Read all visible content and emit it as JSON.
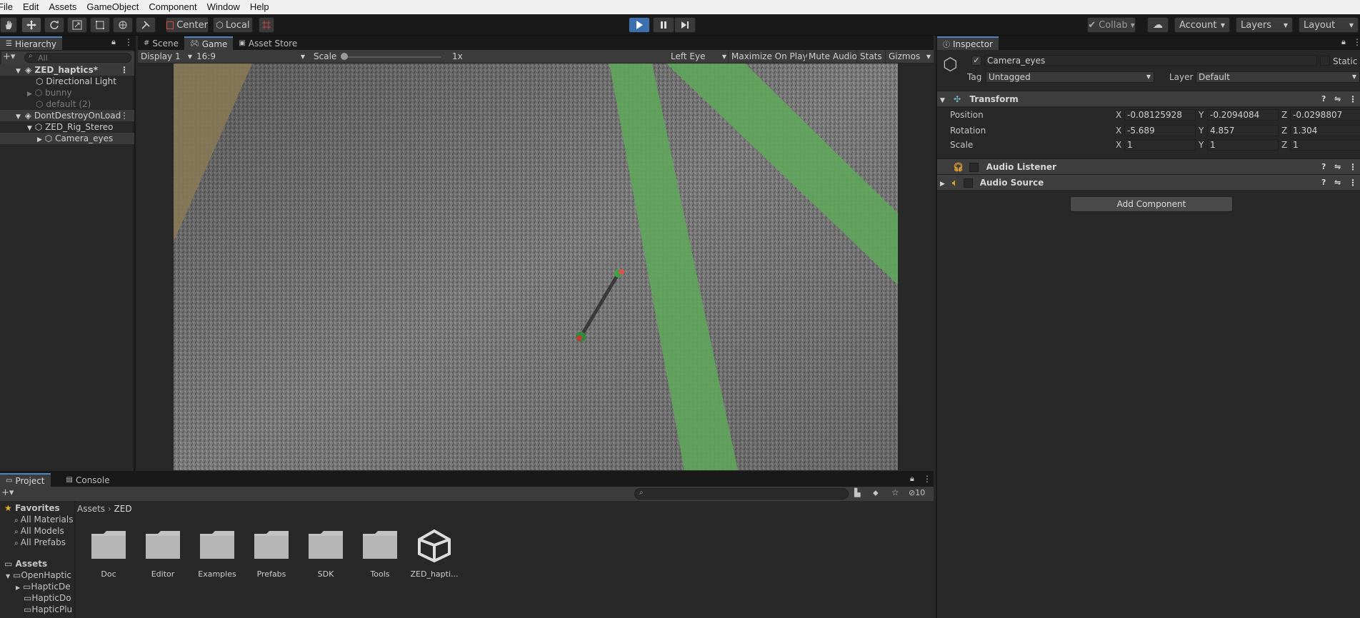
{
  "menu": [
    "File",
    "Edit",
    "Assets",
    "GameObject",
    "Component",
    "Window",
    "Help"
  ],
  "toolbar": {
    "pivot": "Center",
    "space": "Local",
    "collab": "Collab",
    "account": "Account",
    "layers": "Layers",
    "layout": "Layout"
  },
  "hierarchy": {
    "tab": "Hierarchy",
    "search_placeholder": "All",
    "items": [
      {
        "label": "ZED_haptics*"
      },
      {
        "label": "Directional Light"
      },
      {
        "label": "bunny"
      },
      {
        "label": "default (2)"
      },
      {
        "label": "DontDestroyOnLoad"
      },
      {
        "label": "ZED_Rig_Stereo"
      },
      {
        "label": "Camera_eyes"
      }
    ]
  },
  "game": {
    "tabs": [
      "Scene",
      "Game",
      "Asset Store"
    ],
    "display": "Display 1",
    "aspect": "16:9",
    "scale_label": "Scale",
    "scale_value": "1x",
    "eye": "Left Eye",
    "maximize": "Maximize On Play",
    "mute": "Mute Audio",
    "stats": "Stats",
    "gizmos": "Gizmos"
  },
  "inspector": {
    "tab": "Inspector",
    "object_name": "Camera_eyes",
    "static_label": "Static",
    "tag_label": "Tag",
    "tag_value": "Untagged",
    "layer_label": "Layer",
    "layer_value": "Default",
    "transform": {
      "title": "Transform",
      "position_label": "Position",
      "rotation_label": "Rotation",
      "scale_label": "Scale",
      "position": {
        "x": "-0.08125928",
        "y": "-0.2094084",
        "z": "-0.0298807"
      },
      "rotation": {
        "x": "-5.689",
        "y": "4.857",
        "z": "1.304"
      },
      "scale": {
        "x": "1",
        "y": "1",
        "z": "1"
      },
      "axis_x": "X",
      "axis_y": "Y",
      "axis_z": "Z"
    },
    "components": [
      "Audio Listener",
      "Audio Source"
    ],
    "add_component": "Add Component"
  },
  "project": {
    "tabs": [
      "Project",
      "Console"
    ],
    "favorites_label": "Favorites",
    "favorites": [
      "All Materials",
      "All Models",
      "All Prefabs"
    ],
    "assets_label": "Assets",
    "tree": [
      "OpenHaptic",
      "HapticDe",
      "HapticDo",
      "HapticPlu"
    ],
    "breadcrumb": [
      "Assets",
      "ZED"
    ],
    "hidden_count": "10",
    "items": [
      {
        "name": "Doc",
        "type": "folder"
      },
      {
        "name": "Editor",
        "type": "folder"
      },
      {
        "name": "Examples",
        "type": "folder"
      },
      {
        "name": "Prefabs",
        "type": "folder"
      },
      {
        "name": "SDK",
        "type": "folder"
      },
      {
        "name": "Tools",
        "type": "folder"
      },
      {
        "name": "ZED_hapti...",
        "type": "scene"
      }
    ]
  }
}
